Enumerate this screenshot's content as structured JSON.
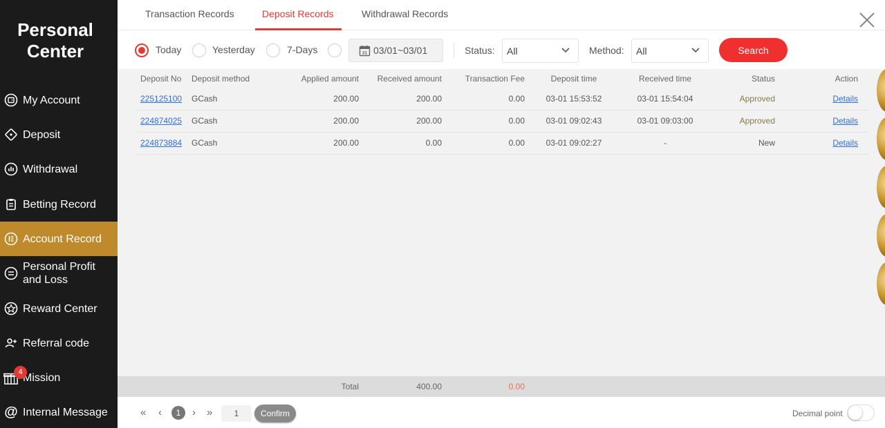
{
  "sidebar": {
    "title_line1": "Personal",
    "title_line2": "Center",
    "items": [
      {
        "label": "My Account",
        "icon": "wallet-icon"
      },
      {
        "label": "Deposit",
        "icon": "deposit-tag-icon"
      },
      {
        "label": "Withdrawal",
        "icon": "withdrawal-chart-icon"
      },
      {
        "label": "Betting Record",
        "icon": "clipboard-icon"
      },
      {
        "label": "Account Record",
        "icon": "ledger-icon"
      },
      {
        "label": "Personal Profit and Loss",
        "icon": "list-icon"
      },
      {
        "label": "Reward Center",
        "icon": "star-icon"
      },
      {
        "label": "Referral code",
        "icon": "user-plus-icon"
      },
      {
        "label": "Mission",
        "icon": "gift-icon",
        "badge": "4"
      },
      {
        "label": "Internal Message",
        "icon": "at-icon"
      }
    ],
    "active_index": 4
  },
  "tabs": [
    {
      "label": "Transaction Records"
    },
    {
      "label": "Deposit Records"
    },
    {
      "label": "Withdrawal Records"
    }
  ],
  "active_tab": 1,
  "filters": {
    "periods": [
      "Today",
      "Yesterday",
      "7-Days"
    ],
    "selected_period": "Today",
    "date_range": "03/01~03/01",
    "status_label": "Status:",
    "status_value": "All",
    "method_label": "Method:",
    "method_value": "All",
    "search_label": "Search"
  },
  "table": {
    "columns": [
      "Deposit No",
      "Deposit method",
      "Applied amount",
      "Received amount",
      "Transaction Fee",
      "Deposit time",
      "Received time",
      "Status",
      "Action"
    ],
    "rows": [
      {
        "deposit_no": "225125100",
        "method": "GCash",
        "applied": "200.00",
        "received": "200.00",
        "fee": "0.00",
        "deposit_time": "03-01 15:53:52",
        "received_time": "03-01 15:54:04",
        "status": "Approved",
        "action": "Details"
      },
      {
        "deposit_no": "224874025",
        "method": "GCash",
        "applied": "200.00",
        "received": "200.00",
        "fee": "0.00",
        "deposit_time": "03-01 09:02:43",
        "received_time": "03-01 09:03:00",
        "status": "Approved",
        "action": "Details"
      },
      {
        "deposit_no": "224873884",
        "method": "GCash",
        "applied": "200.00",
        "received": "0.00",
        "fee": "0.00",
        "deposit_time": "03-01 09:02:27",
        "received_time": "-",
        "status": "New",
        "action": "Details"
      }
    ]
  },
  "totals": {
    "label": "Total",
    "received": "400.00",
    "fee": "0.00"
  },
  "pagination": {
    "first": "«",
    "prev": "‹",
    "current_page": "1",
    "next": "›",
    "last": "»",
    "page_input": "1",
    "confirm_label": "Confirm"
  },
  "decimal_point": {
    "label": "Decimal point",
    "enabled": false
  },
  "colors": {
    "sidebar_bg": "#1b1b1b",
    "active_item": "#bf8a2c",
    "accent_red": "#e53935",
    "search_button": "#f0302e",
    "link": "#2f6fd6"
  }
}
